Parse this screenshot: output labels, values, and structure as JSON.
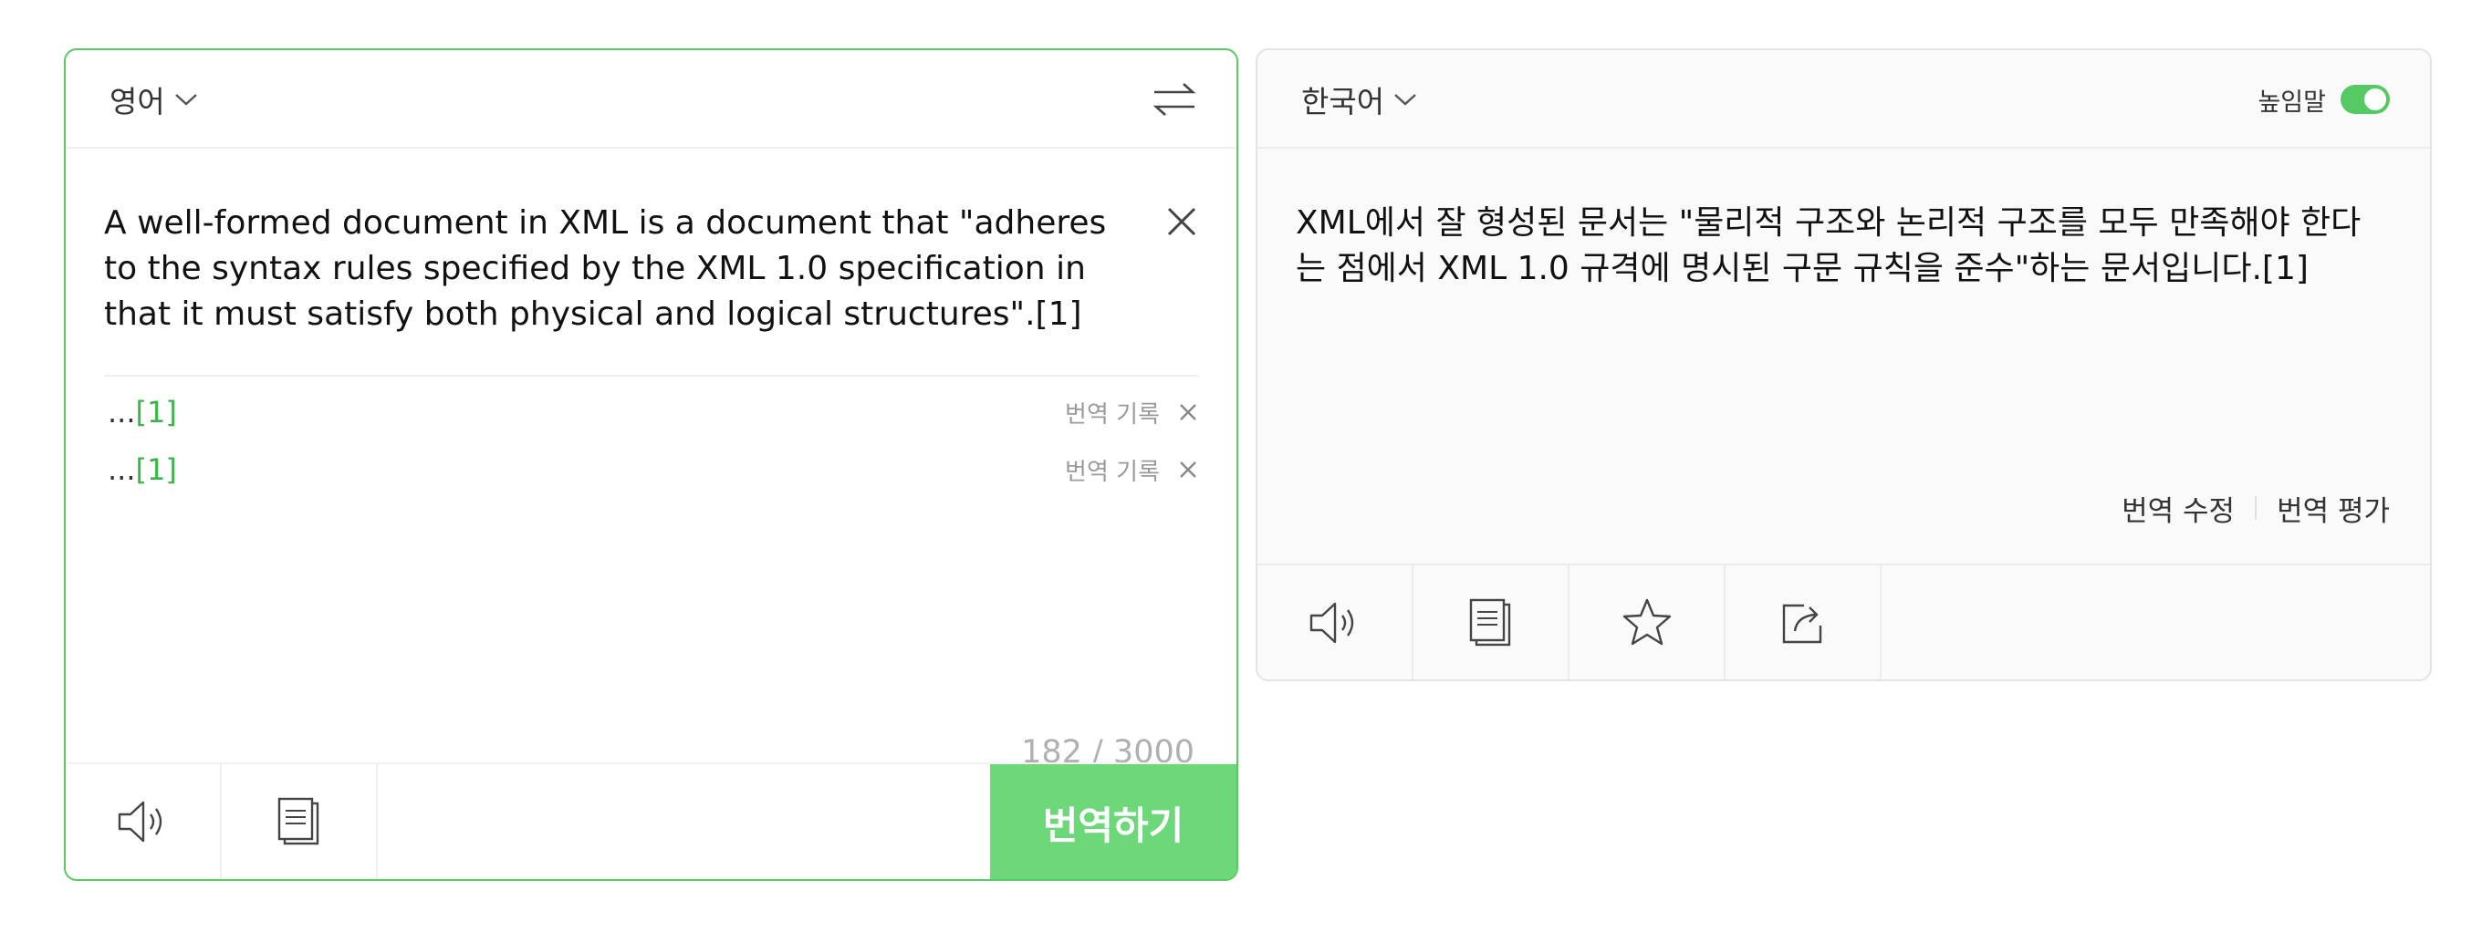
{
  "source": {
    "language": "영어",
    "text": "A well-formed document in XML is a document that \"adheres to the syntax rules specified by the XML 1.0 specification in that it must satisfy both physical and logical structures\".[1]",
    "suggestions": [
      {
        "ellipsis": "...",
        "ref": "[1]",
        "history_label": "번역 기록"
      },
      {
        "ellipsis": "...",
        "ref": "[1]",
        "history_label": "번역 기록"
      }
    ],
    "char_count": "182 / 3000",
    "translate_label": "번역하기"
  },
  "target": {
    "language": "한국어",
    "honorific_label": "높임말",
    "honorific_on": true,
    "text": "XML에서 잘 형성된 문서는 \"물리적 구조와 논리적 구조를 모두 만족해야 한다는 점에서 XML 1.0 규격에 명시된 구문 규칙을 준수\"하는 문서입니다.[1]",
    "edit_label": "번역 수정",
    "rate_label": "번역 평가"
  },
  "colors": {
    "accent": "#59c964",
    "button": "#6cd87a",
    "ref_link": "#3bb54a"
  },
  "icons": {
    "source_toolbar": [
      "speaker-icon",
      "copy-icon"
    ],
    "target_toolbar": [
      "speaker-icon",
      "copy-icon",
      "star-icon",
      "share-icon"
    ]
  }
}
